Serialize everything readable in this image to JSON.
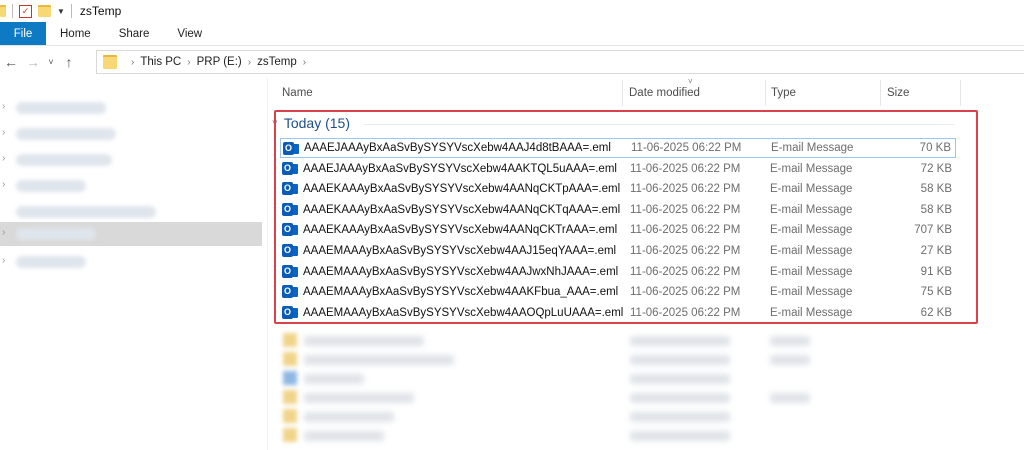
{
  "window": {
    "title": "zsTemp"
  },
  "ribbon": {
    "tabs": [
      "File",
      "Home",
      "Share",
      "View"
    ]
  },
  "address": {
    "crumbs": [
      "This PC",
      "PRP (E:)",
      "zsTemp"
    ]
  },
  "columns": {
    "name": "Name",
    "date": "Date modified",
    "type": "Type",
    "size": "Size"
  },
  "group": {
    "label": "Today (15)"
  },
  "files": [
    {
      "name": "AAAEJAAAyBxAaSvBySYSYVscXebw4AAJ4d8tBAAA=.eml",
      "date": "11-06-2025 06:22 PM",
      "type": "E-mail Message",
      "size": "70 KB"
    },
    {
      "name": "AAAEJAAAyBxAaSvBySYSYVscXebw4AAKTQL5uAAA=.eml",
      "date": "11-06-2025 06:22 PM",
      "type": "E-mail Message",
      "size": "72 KB"
    },
    {
      "name": "AAAEKAAAyBxAaSvBySYSYVscXebw4AANqCKTpAAA=.eml",
      "date": "11-06-2025 06:22 PM",
      "type": "E-mail Message",
      "size": "58 KB"
    },
    {
      "name": "AAAEKAAAyBxAaSvBySYSYVscXebw4AANqCKTqAAA=.eml",
      "date": "11-06-2025 06:22 PM",
      "type": "E-mail Message",
      "size": "58 KB"
    },
    {
      "name": "AAAEKAAAyBxAaSvBySYSYVscXebw4AANqCKTrAAA=.eml",
      "date": "11-06-2025 06:22 PM",
      "type": "E-mail Message",
      "size": "707 KB"
    },
    {
      "name": "AAAEMAAAyBxAaSvBySYSYVscXebw4AAJ15eqYAAA=.eml",
      "date": "11-06-2025 06:22 PM",
      "type": "E-mail Message",
      "size": "27 KB"
    },
    {
      "name": "AAAEMAAAyBxAaSvBySYSYVscXebw4AAJwxNhJAAA=.eml",
      "date": "11-06-2025 06:22 PM",
      "type": "E-mail Message",
      "size": "91 KB"
    },
    {
      "name": "AAAEMAAAyBxAaSvBySYSYVscXebw4AAKFbua_AAA=.eml",
      "date": "11-06-2025 06:22 PM",
      "type": "E-mail Message",
      "size": "75 KB"
    },
    {
      "name": "AAAEMAAAyBxAaSvBySYSYVscXebw4AAOQpLuUAAA=.eml",
      "date": "11-06-2025 06:22 PM",
      "type": "E-mail Message",
      "size": "62 KB"
    }
  ],
  "colors": {
    "file_tab": "#0e7ac4",
    "highlight": "#d9424b",
    "group_text": "#1f4e8c"
  },
  "icons": {
    "file": "outlook-email-icon",
    "folder": "folder-icon"
  }
}
